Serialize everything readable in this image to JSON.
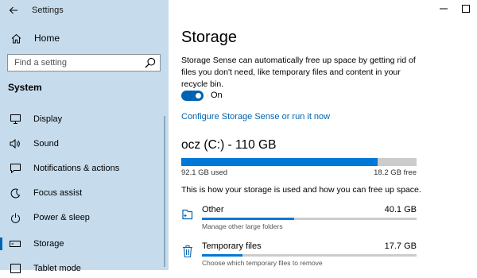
{
  "window": {
    "app_title": "Settings"
  },
  "sidebar": {
    "home_label": "Home",
    "search_placeholder": "Find a setting",
    "section_label": "System",
    "items": [
      {
        "label": "Display",
        "icon": "display-icon",
        "active": false
      },
      {
        "label": "Sound",
        "icon": "sound-icon",
        "active": false
      },
      {
        "label": "Notifications & actions",
        "icon": "notifications-icon",
        "active": false
      },
      {
        "label": "Focus assist",
        "icon": "focus-assist-icon",
        "active": false
      },
      {
        "label": "Power & sleep",
        "icon": "power-icon",
        "active": false
      },
      {
        "label": "Storage",
        "icon": "storage-icon",
        "active": true
      },
      {
        "label": "Tablet mode",
        "icon": "tablet-mode-icon",
        "active": false
      }
    ]
  },
  "main": {
    "title": "Storage",
    "description": "Storage Sense can automatically free up space by getting rid of files you don't need, like temporary files and content in your recycle bin.",
    "toggle_state_label": "On",
    "toggle_on": true,
    "configure_link": "Configure Storage Sense or run it now",
    "drive": {
      "title": "ocz (C:) - 110 GB",
      "used_label": "92.1 GB used",
      "free_label": "18.2 GB free",
      "used_fraction": 0.835
    },
    "howto_text": "This is how your storage is used and how you can free up space.",
    "categories": [
      {
        "name": "Other",
        "size": "40.1 GB",
        "subtitle": "Manage other large folders",
        "fraction": 0.43,
        "icon": "folder-icon"
      },
      {
        "name": "Temporary files",
        "size": "17.7 GB",
        "subtitle": "Choose which temporary files to remove",
        "fraction": 0.19,
        "icon": "trash-icon"
      }
    ]
  },
  "colors": {
    "accent": "#0078d7",
    "link": "#0063b1",
    "sidebar_bg": "#c6dced",
    "bar_bg": "#cccccc"
  }
}
